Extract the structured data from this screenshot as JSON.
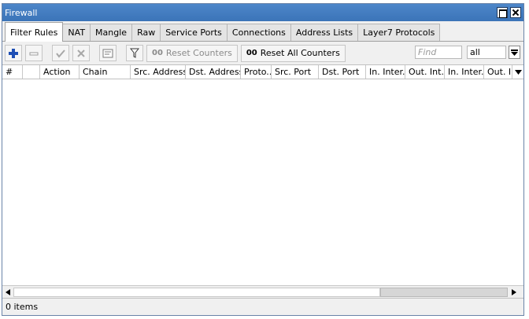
{
  "window": {
    "title": "Firewall"
  },
  "tabs": [
    {
      "label": "Filter Rules",
      "active": true
    },
    {
      "label": "NAT"
    },
    {
      "label": "Mangle"
    },
    {
      "label": "Raw"
    },
    {
      "label": "Service Ports"
    },
    {
      "label": "Connections"
    },
    {
      "label": "Address Lists"
    },
    {
      "label": "Layer7 Protocols"
    }
  ],
  "toolbar": {
    "reset_counters": {
      "prefix": "00",
      "label": "Reset Counters"
    },
    "reset_all_counters": {
      "prefix": "00",
      "label": "Reset All Counters"
    },
    "find_placeholder": "Find",
    "filter_value": "all"
  },
  "table": {
    "columns": [
      {
        "label": "#",
        "width": 26
      },
      {
        "label": "",
        "width": 22
      },
      {
        "label": "Action",
        "width": 50
      },
      {
        "label": "Chain",
        "width": 65
      },
      {
        "label": "Src. Address",
        "width": 70
      },
      {
        "label": "Dst. Address",
        "width": 70
      },
      {
        "label": "Proto...",
        "width": 39
      },
      {
        "label": "Src. Port",
        "width": 60
      },
      {
        "label": "Dst. Port",
        "width": 60
      },
      {
        "label": "In. Inter...",
        "width": 50
      },
      {
        "label": "Out. Int...",
        "width": 50
      },
      {
        "label": "In. Inter...",
        "width": 50
      },
      {
        "label": "Out. Ir",
        "width": 36
      }
    ],
    "rows": []
  },
  "status": {
    "items": "0 items"
  },
  "colors": {
    "titlebar": "#3b74b8",
    "add_icon": "#1e4fb4"
  }
}
